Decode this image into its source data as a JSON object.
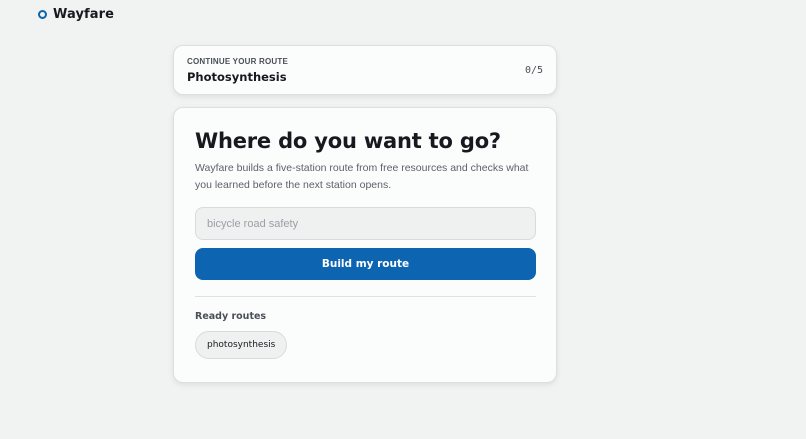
{
  "brand": {
    "name": "Wayfare",
    "accent_color": "#0d64a8"
  },
  "continue_route": {
    "eyebrow": "CONTINUE YOUR ROUTE",
    "title": "Photosynthesis",
    "progress": "0/5"
  },
  "main": {
    "headline": "Where do you want to go?",
    "description": "Wayfare builds a five-station route from free resources and checks what you learned before the next station opens.",
    "topic_input": {
      "value": "",
      "placeholder": "bicycle road safety"
    },
    "build_button_label": "Build my route",
    "ready_routes_label": "Ready routes",
    "ready_routes": [
      {
        "label": "photosynthesis"
      }
    ]
  },
  "colors": {
    "background": "#f1f2f2",
    "card": "#fbfcfc",
    "primary_button": "#0d64b0",
    "text": "#16191d",
    "muted_text": "#5b626a"
  }
}
